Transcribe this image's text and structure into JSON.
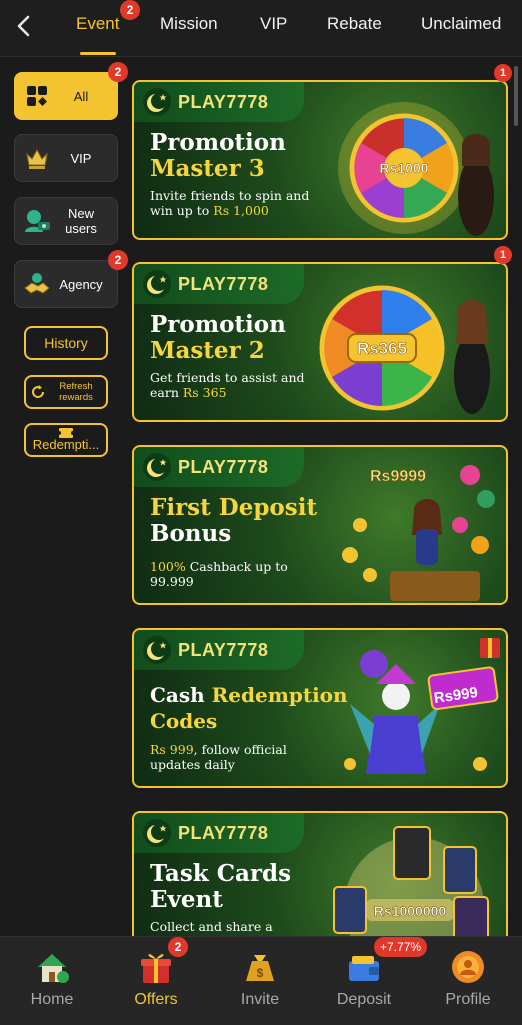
{
  "header": {
    "tabs": [
      {
        "label": "Event",
        "badge": "2",
        "active": true
      },
      {
        "label": "Mission"
      },
      {
        "label": "VIP"
      },
      {
        "label": "Rebate"
      },
      {
        "label": "Unclaimed"
      }
    ]
  },
  "sidebar": {
    "items": [
      {
        "label": "All",
        "badge": "2",
        "icon": "grid-icon",
        "active": true
      },
      {
        "label": "VIP",
        "icon": "crown-icon"
      },
      {
        "label": "New users",
        "icon": "new-user-icon"
      },
      {
        "label": "Agency",
        "badge": "2",
        "icon": "handshake-icon"
      }
    ],
    "history_label": "History",
    "refresh_label": "Refresh rewards",
    "redemption_label": "Redempti..."
  },
  "banners": [
    {
      "brand": "PLAY7778",
      "title_line1": "Promotion",
      "title_line2": "Master 3",
      "desc_plain": "Invite friends to spin and win up to ",
      "desc_highlight": "Rs 1,000",
      "art_label": "Rs1000",
      "badge": "1"
    },
    {
      "brand": "PLAY7778",
      "title_line1": "Promotion",
      "title_line2": "Master 2",
      "desc_plain": "Get friends to assist and earn ",
      "desc_highlight": "Rs 365",
      "art_label": "Rs365",
      "badge": "1"
    },
    {
      "brand": "PLAY7778",
      "title_line1": "First Deposit",
      "title_line2": "Bonus",
      "desc_highlight": "100%",
      "desc_plain": " Cashback up to 99.999",
      "art_label": "Rs9999"
    },
    {
      "brand": "PLAY7778",
      "title_white": "Cash ",
      "title_yellow": "Redemption",
      "title_line2": "Codes",
      "desc_highlight": "Rs 999",
      "desc_plain": ", follow official updates daily",
      "art_label": "Rs999"
    },
    {
      "brand": "PLAY7778",
      "title_line1": "Task Cards",
      "title_line2": "Event",
      "desc_plain": "Collect and share a",
      "art_label": "Rs1000000"
    }
  ],
  "bottom_nav": [
    {
      "label": "Home",
      "icon": "home-icon"
    },
    {
      "label": "Offers",
      "icon": "gift-icon",
      "badge": "2",
      "active": true
    },
    {
      "label": "Invite",
      "icon": "money-bag-icon"
    },
    {
      "label": "Deposit",
      "icon": "wallet-icon",
      "badge": "+7.77%"
    },
    {
      "label": "Profile",
      "icon": "profile-coin-icon"
    }
  ],
  "colors": {
    "accent": "#f4c430",
    "badge": "#e0392b",
    "background": "#1b1b1b",
    "banner_green": "#1e4a1c"
  }
}
